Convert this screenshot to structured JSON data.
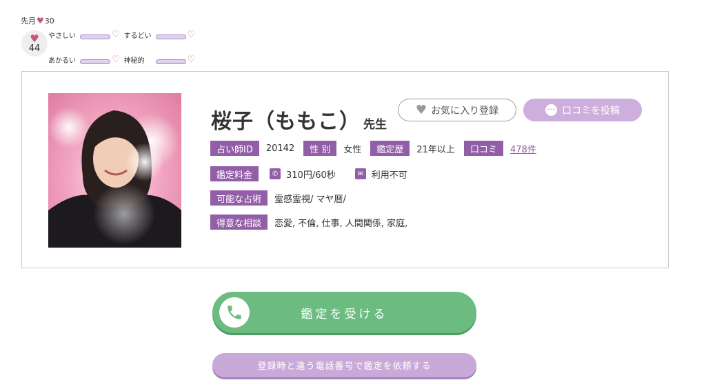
{
  "ratings": {
    "last_month_label": "先月",
    "last_month_count": "30",
    "total_hearts": "44",
    "traits": [
      {
        "label": "やさしい"
      },
      {
        "label": "するどい"
      },
      {
        "label": "あかるい"
      },
      {
        "label": "神秘的"
      }
    ],
    "heart_color": "#c9547f"
  },
  "profile": {
    "name": "桜子（ももこ）",
    "suffix": "先生",
    "favorite_button": "お気に入り登録",
    "review_button": "口コミを投稿",
    "fields": {
      "id_label": "占い師ID",
      "id_value": "20142",
      "gender_label": "性 別",
      "gender_value": "女性",
      "experience_label": "鑑定歴",
      "experience_value": "21年以上",
      "reviews_label": "口コミ",
      "reviews_value": "478件",
      "fee_label": "鑑定料金",
      "fee_phone": "310円/60秒",
      "fee_mail": "利用不可",
      "methods_label": "可能な占術",
      "methods_value": "霊感霊視/ マヤ暦/",
      "specialties_label": "得意な相談",
      "specialties_value": "恋愛, 不倫, 仕事, 人間関係, 家庭,"
    },
    "accent_color": "#935ea8"
  },
  "actions": {
    "call_label": "鑑定を受ける",
    "alt_call_label": "登録時と違う電話番号で鑑定を依頼する",
    "call_color": "#6cbc82",
    "alt_color": "#c9a9d8"
  }
}
